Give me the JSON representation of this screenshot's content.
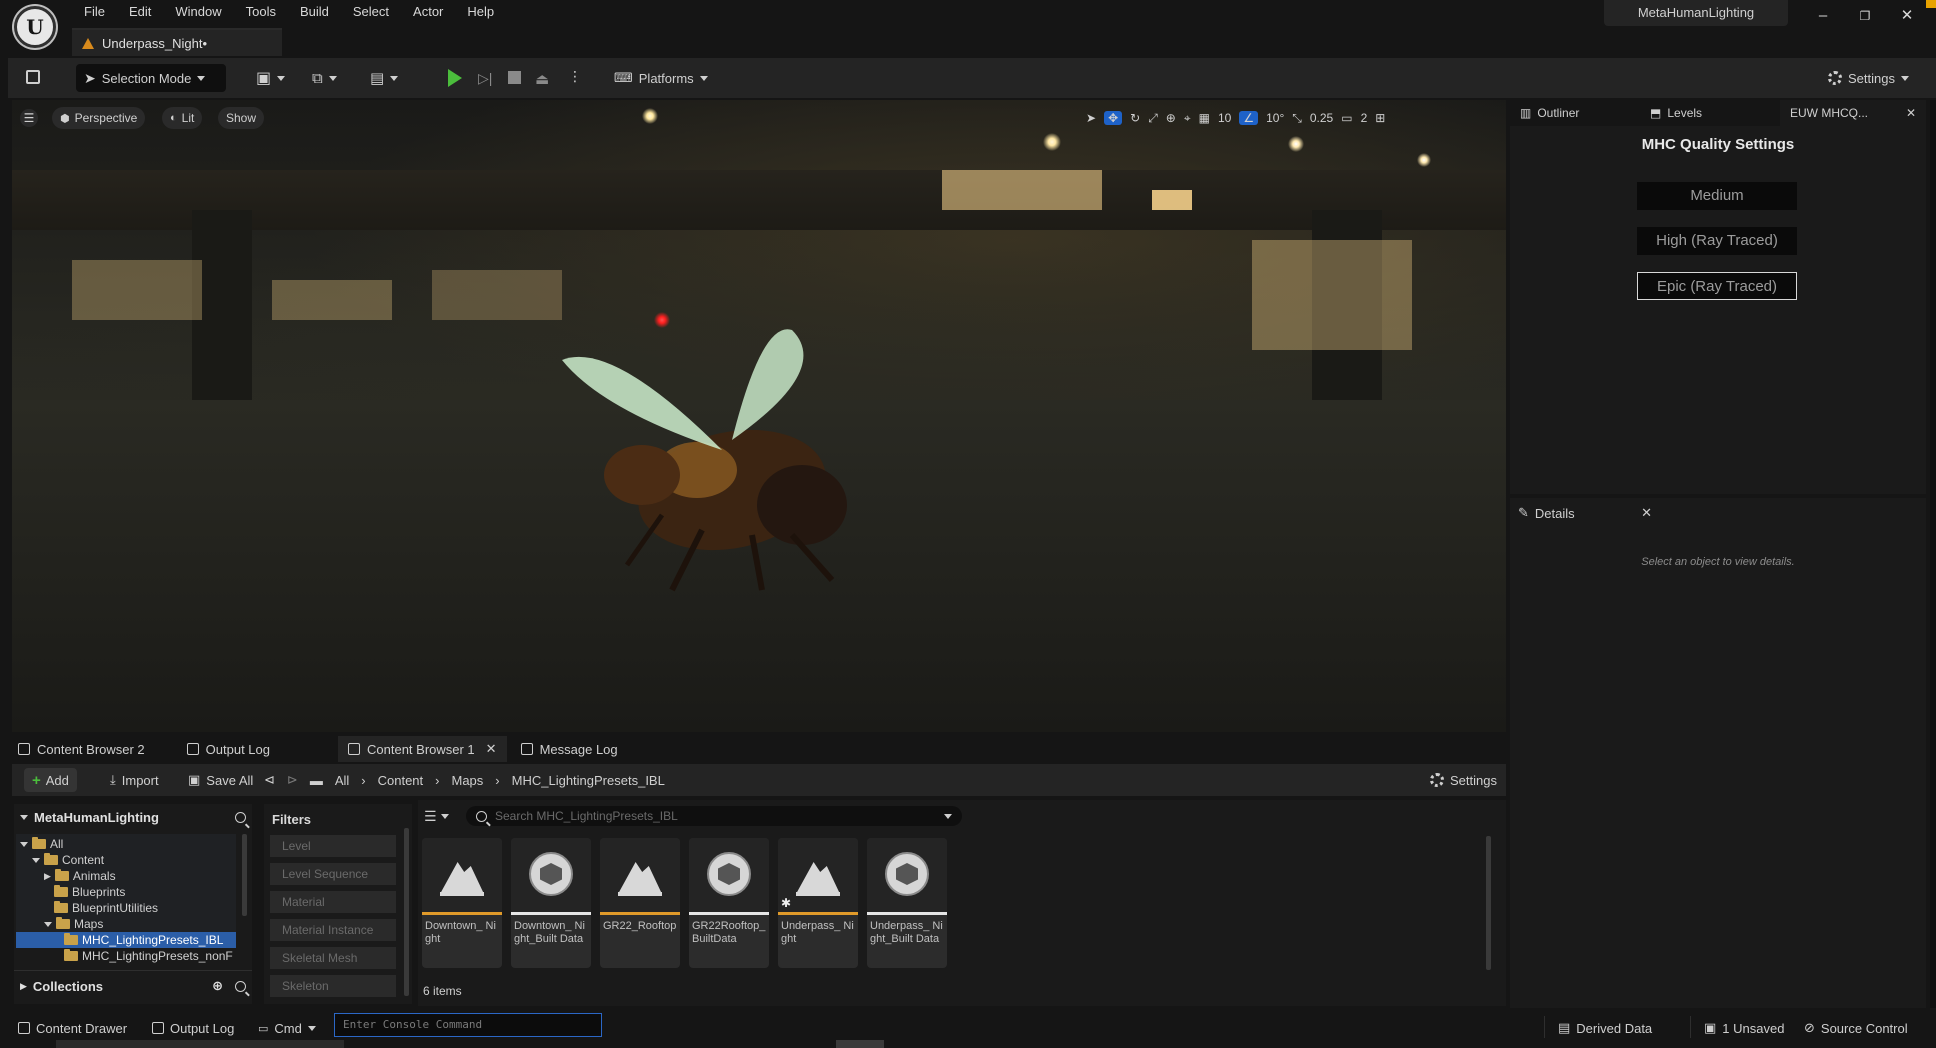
{
  "app": {
    "logo": "unreal-logo",
    "menu": [
      "File",
      "Edit",
      "Window",
      "Tools",
      "Build",
      "Select",
      "Actor",
      "Help"
    ],
    "document_tab": "Underpass_Night•",
    "project_name": "MetaHumanLighting",
    "window_controls": [
      "–",
      "❐",
      "✕"
    ]
  },
  "toolbar": {
    "selection_mode": "Selection Mode",
    "platforms": "Platforms",
    "settings": "Settings"
  },
  "viewport": {
    "perspective": "Perspective",
    "lit": "Lit",
    "show": "Show",
    "grid_snap": "10",
    "rotation_snap": "10°",
    "scale_snap": "0.25",
    "camera_speed": "2"
  },
  "right_panel": {
    "tabs": [
      "Outliner",
      "Levels",
      "EUW MHCQ..."
    ],
    "quality_title": "MHC Quality Settings",
    "quality_buttons": [
      "Medium",
      "High (Ray Traced)",
      "Epic (Ray Traced)"
    ],
    "details_tab": "Details",
    "details_empty": "Select an object to view details."
  },
  "bottom_tabs": [
    "Content Browser 2",
    "Output Log",
    "Content Browser 1",
    "Message Log"
  ],
  "content_browser": {
    "add": "Add",
    "import": "Import",
    "save_all": "Save All",
    "breadcrumbs": [
      "All",
      "Content",
      "Maps",
      "MHC_LightingPresets_IBL"
    ],
    "settings": "Settings",
    "tree_root": "MetaHumanLighting",
    "tree": [
      "All",
      "Content",
      "Animals",
      "Blueprints",
      "BlueprintUtilities",
      "Maps",
      "MHC_LightingPresets_IBL",
      "MHC_LightingPresets_nonF"
    ],
    "collections": "Collections",
    "filters_title": "Filters",
    "filters": [
      "Level",
      "Level Sequence",
      "Material",
      "Material Instance",
      "Skeletal Mesh",
      "Skeleton"
    ],
    "search_placeholder": "Search MHC_LightingPresets_IBL",
    "item_count": "6 items",
    "assets": [
      {
        "name": "Downtown_ Night",
        "kind": "level",
        "bar": "#e09a2a"
      },
      {
        "name": "Downtown_ Night_Built Data",
        "kind": "data",
        "bar": "#e6e6e6"
      },
      {
        "name": "GR22_Rooftop",
        "kind": "level",
        "bar": "#e09a2a"
      },
      {
        "name": "GR22Rooftop_ BuiltData",
        "kind": "data",
        "bar": "#e6e6e6"
      },
      {
        "name": "Underpass_ Night",
        "kind": "level",
        "bar": "#e09a2a"
      },
      {
        "name": "Underpass_ Night_Built Data",
        "kind": "data",
        "bar": "#e6e6e6"
      }
    ]
  },
  "statusbar": {
    "content_drawer": "Content Drawer",
    "output_log": "Output Log",
    "cmd": "Cmd",
    "console_placeholder": "Enter Console Command",
    "derived_data": "Derived Data",
    "unsaved": "1 Unsaved",
    "source_control": "Source Control"
  }
}
